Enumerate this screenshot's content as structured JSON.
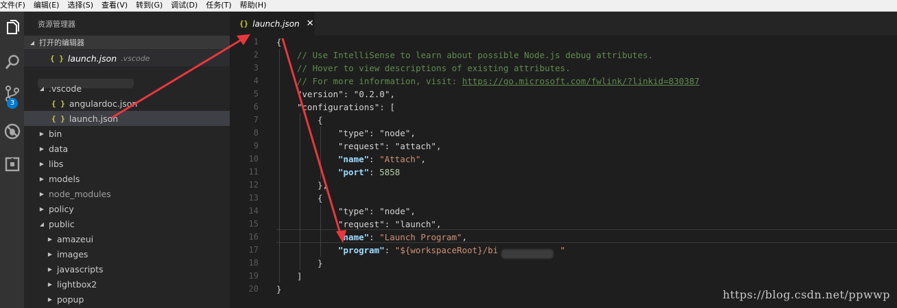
{
  "menubar": [
    "文件(F)",
    "编辑(E)",
    "选择(S)",
    "查看(V)",
    "转到(G)",
    "调试(D)",
    "任务(T)",
    "帮助(H)"
  ],
  "activity": {
    "icons": [
      "files-icon",
      "search-icon",
      "source-control-icon",
      "debug-icon",
      "extensions-icon"
    ],
    "scm_badge": "3"
  },
  "sidebar": {
    "title": "资源管理器",
    "open_editors_header": "打开的编辑器",
    "open_editor": {
      "name": "launch.json",
      "folder": ".vscode"
    },
    "tree": [
      {
        "label": ".vscode",
        "kind": "folder-open",
        "depth": 0
      },
      {
        "label": "angulardoc.json",
        "kind": "json",
        "depth": 1
      },
      {
        "label": "launch.json",
        "kind": "json",
        "depth": 1,
        "selected": true
      },
      {
        "label": "bin",
        "kind": "folder",
        "depth": 0
      },
      {
        "label": "data",
        "kind": "folder",
        "depth": 0
      },
      {
        "label": "libs",
        "kind": "folder",
        "depth": 0
      },
      {
        "label": "models",
        "kind": "folder",
        "depth": 0
      },
      {
        "label": "node_modules",
        "kind": "folder",
        "depth": 0,
        "dim": true
      },
      {
        "label": "policy",
        "kind": "folder",
        "depth": 0
      },
      {
        "label": "public",
        "kind": "folder-open",
        "depth": 0
      },
      {
        "label": "amazeui",
        "kind": "folder",
        "depth": 1
      },
      {
        "label": "images",
        "kind": "folder",
        "depth": 1
      },
      {
        "label": "javascripts",
        "kind": "folder",
        "depth": 1
      },
      {
        "label": "lightbox2",
        "kind": "folder",
        "depth": 1
      },
      {
        "label": "popup",
        "kind": "folder",
        "depth": 1
      }
    ]
  },
  "tab": {
    "icon": "{}",
    "label": "launch.json",
    "close": "✕"
  },
  "editor": {
    "line_numbers": [
      "1",
      "2",
      "3",
      "4",
      "5",
      "6",
      "7",
      "8",
      "9",
      "10",
      "11",
      "12",
      "13",
      "14",
      "15",
      "16",
      "17",
      "18",
      "19",
      "20"
    ],
    "lines": [
      {
        "indent": 0,
        "parts": [
          {
            "t": "{",
            "c": "p"
          }
        ]
      },
      {
        "indent": 1,
        "parts": [
          {
            "t": "// Use IntelliSense to learn about possible Node.js debug attributes.",
            "c": "cmt"
          }
        ]
      },
      {
        "indent": 1,
        "parts": [
          {
            "t": "// Hover to view descriptions of existing attributes.",
            "c": "cmt"
          }
        ]
      },
      {
        "indent": 1,
        "parts": [
          {
            "t": "// For more information, visit: ",
            "c": "cmt"
          },
          {
            "t": "https://go.microsoft.com/fwlink/?linkid=830387",
            "c": "lnk"
          }
        ]
      },
      {
        "indent": 1,
        "parts": [
          {
            "t": "\"version\"",
            "c": "key"
          },
          {
            "t": ": ",
            "c": "p"
          },
          {
            "t": "\"0.2.0\"",
            "c": "key"
          },
          {
            "t": ",",
            "c": "p"
          }
        ]
      },
      {
        "indent": 1,
        "parts": [
          {
            "t": "\"configurations\"",
            "c": "key"
          },
          {
            "t": ": [",
            "c": "p"
          }
        ]
      },
      {
        "indent": 2,
        "parts": [
          {
            "t": "{",
            "c": "p"
          }
        ]
      },
      {
        "indent": 3,
        "parts": [
          {
            "t": "\"type\"",
            "c": "key"
          },
          {
            "t": ": ",
            "c": "p"
          },
          {
            "t": "\"node\"",
            "c": "key"
          },
          {
            "t": ",",
            "c": "p"
          }
        ]
      },
      {
        "indent": 3,
        "parts": [
          {
            "t": "\"request\"",
            "c": "key"
          },
          {
            "t": ": ",
            "c": "p"
          },
          {
            "t": "\"attach\"",
            "c": "key"
          },
          {
            "t": ",",
            "c": "p"
          }
        ]
      },
      {
        "indent": 3,
        "parts": [
          {
            "t": "\"name\"",
            "c": "kbold"
          },
          {
            "t": ": ",
            "c": "p"
          },
          {
            "t": "\"Attach\"",
            "c": "str"
          },
          {
            "t": ",",
            "c": "p"
          }
        ]
      },
      {
        "indent": 3,
        "parts": [
          {
            "t": "\"port\"",
            "c": "kbold"
          },
          {
            "t": ": ",
            "c": "p"
          },
          {
            "t": "5858",
            "c": "num"
          }
        ]
      },
      {
        "indent": 2,
        "parts": [
          {
            "t": "},",
            "c": "p"
          }
        ]
      },
      {
        "indent": 2,
        "parts": [
          {
            "t": "{",
            "c": "p"
          }
        ]
      },
      {
        "indent": 3,
        "parts": [
          {
            "t": "\"type\"",
            "c": "key"
          },
          {
            "t": ": ",
            "c": "p"
          },
          {
            "t": "\"node\"",
            "c": "key"
          },
          {
            "t": ",",
            "c": "p"
          }
        ]
      },
      {
        "indent": 3,
        "parts": [
          {
            "t": "\"request\"",
            "c": "key"
          },
          {
            "t": ": ",
            "c": "p"
          },
          {
            "t": "\"launch\"",
            "c": "key"
          },
          {
            "t": ",",
            "c": "p"
          }
        ]
      },
      {
        "indent": 3,
        "parts": [
          {
            "t": "\"name\"",
            "c": "kbold"
          },
          {
            "t": ": ",
            "c": "p"
          },
          {
            "t": "\"Launch Program\"",
            "c": "str"
          },
          {
            "t": ",",
            "c": "p"
          }
        ]
      },
      {
        "indent": 3,
        "parts": [
          {
            "t": "\"program\"",
            "c": "kbold"
          },
          {
            "t": ": ",
            "c": "p"
          },
          {
            "t": "\"${workspaceRoot}/bi",
            "c": "str"
          },
          {
            "t": "            ",
            "c": "p"
          },
          {
            "t": "\"",
            "c": "str"
          }
        ]
      },
      {
        "indent": 2,
        "parts": [
          {
            "t": "}",
            "c": "p"
          }
        ]
      },
      {
        "indent": 1,
        "parts": [
          {
            "t": "]",
            "c": "p"
          }
        ]
      },
      {
        "indent": 0,
        "parts": [
          {
            "t": "}",
            "c": "p"
          }
        ]
      }
    ]
  },
  "watermark": "https://blog.csdn.net/ppwwp",
  "colors": {
    "annotation_arrow": "#e8383d",
    "accent": "#007acc"
  }
}
